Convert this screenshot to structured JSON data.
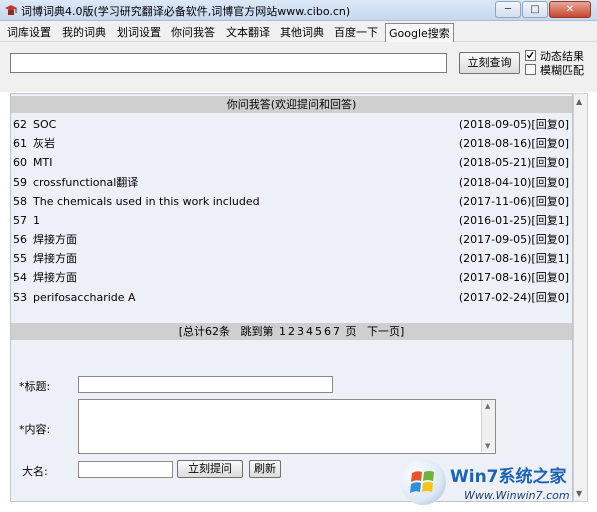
{
  "window": {
    "title": "词博词典4.0版(学习研究翻译必备软件,词博官方网站www.cibo.cn)",
    "minimize": "─",
    "maximize": "□",
    "close": "✕"
  },
  "menu": {
    "items": [
      "词库设置",
      "我的词典",
      "划词设置",
      "你问我答",
      "文本翻译",
      "其他词典",
      "百度一下"
    ],
    "google": "Google搜索"
  },
  "search": {
    "value": "",
    "button": "立刻查询",
    "options": [
      {
        "label": "动态结果",
        "checked": true
      },
      {
        "label": "模糊匹配",
        "checked": false
      }
    ]
  },
  "qa": {
    "header": "你问我答(欢迎提问和回答)",
    "rows": [
      {
        "id": "62",
        "title": "SOC",
        "date": "(2018-09-05)",
        "reply": "[回复0]"
      },
      {
        "id": "61",
        "title": "灰岩",
        "date": "(2018-08-16)",
        "reply": "[回复0]"
      },
      {
        "id": "60",
        "title": "MTI",
        "date": "(2018-05-21)",
        "reply": "[回复0]"
      },
      {
        "id": "59",
        "title": "crossfunctional翻译",
        "date": "(2018-04-10)",
        "reply": "[回复0]"
      },
      {
        "id": "58",
        "title": "The chemicals used in this work included",
        "date": "(2017-11-06)",
        "reply": "[回复0]"
      },
      {
        "id": "57",
        "title": "1",
        "date": "(2016-01-25)",
        "reply": "[回复1]"
      },
      {
        "id": "56",
        "title": "焊接方面",
        "date": "(2017-09-05)",
        "reply": "[回复0]"
      },
      {
        "id": "55",
        "title": "焊接方面",
        "date": "(2017-08-16)",
        "reply": "[回复1]"
      },
      {
        "id": "54",
        "title": "焊接方面",
        "date": "(2017-08-16)",
        "reply": "[回复0]"
      },
      {
        "id": "53",
        "title": "perifosaccharide A",
        "date": "(2017-02-24)",
        "reply": "[回复0]"
      }
    ],
    "pager": {
      "total": "[总计62条",
      "jump": "跳到第",
      "pages": [
        "1",
        "2",
        "3",
        "4",
        "5",
        "6",
        "7"
      ],
      "page_unit": "页",
      "next": "下一页]"
    }
  },
  "form": {
    "title_label": "*标题:",
    "content_label": "*内容:",
    "name_label": "大名:",
    "submit": "立刻提问",
    "refresh": "刷新"
  },
  "watermark": {
    "title": "Win7系统之家",
    "url": "Www.Winwin7.com"
  },
  "colors": {
    "title_gradient_top": "#dce8f6",
    "panel_bg": "#eef0f8",
    "header_bg": "#cfcfcf",
    "watermark_blue": "#1a63b5"
  }
}
